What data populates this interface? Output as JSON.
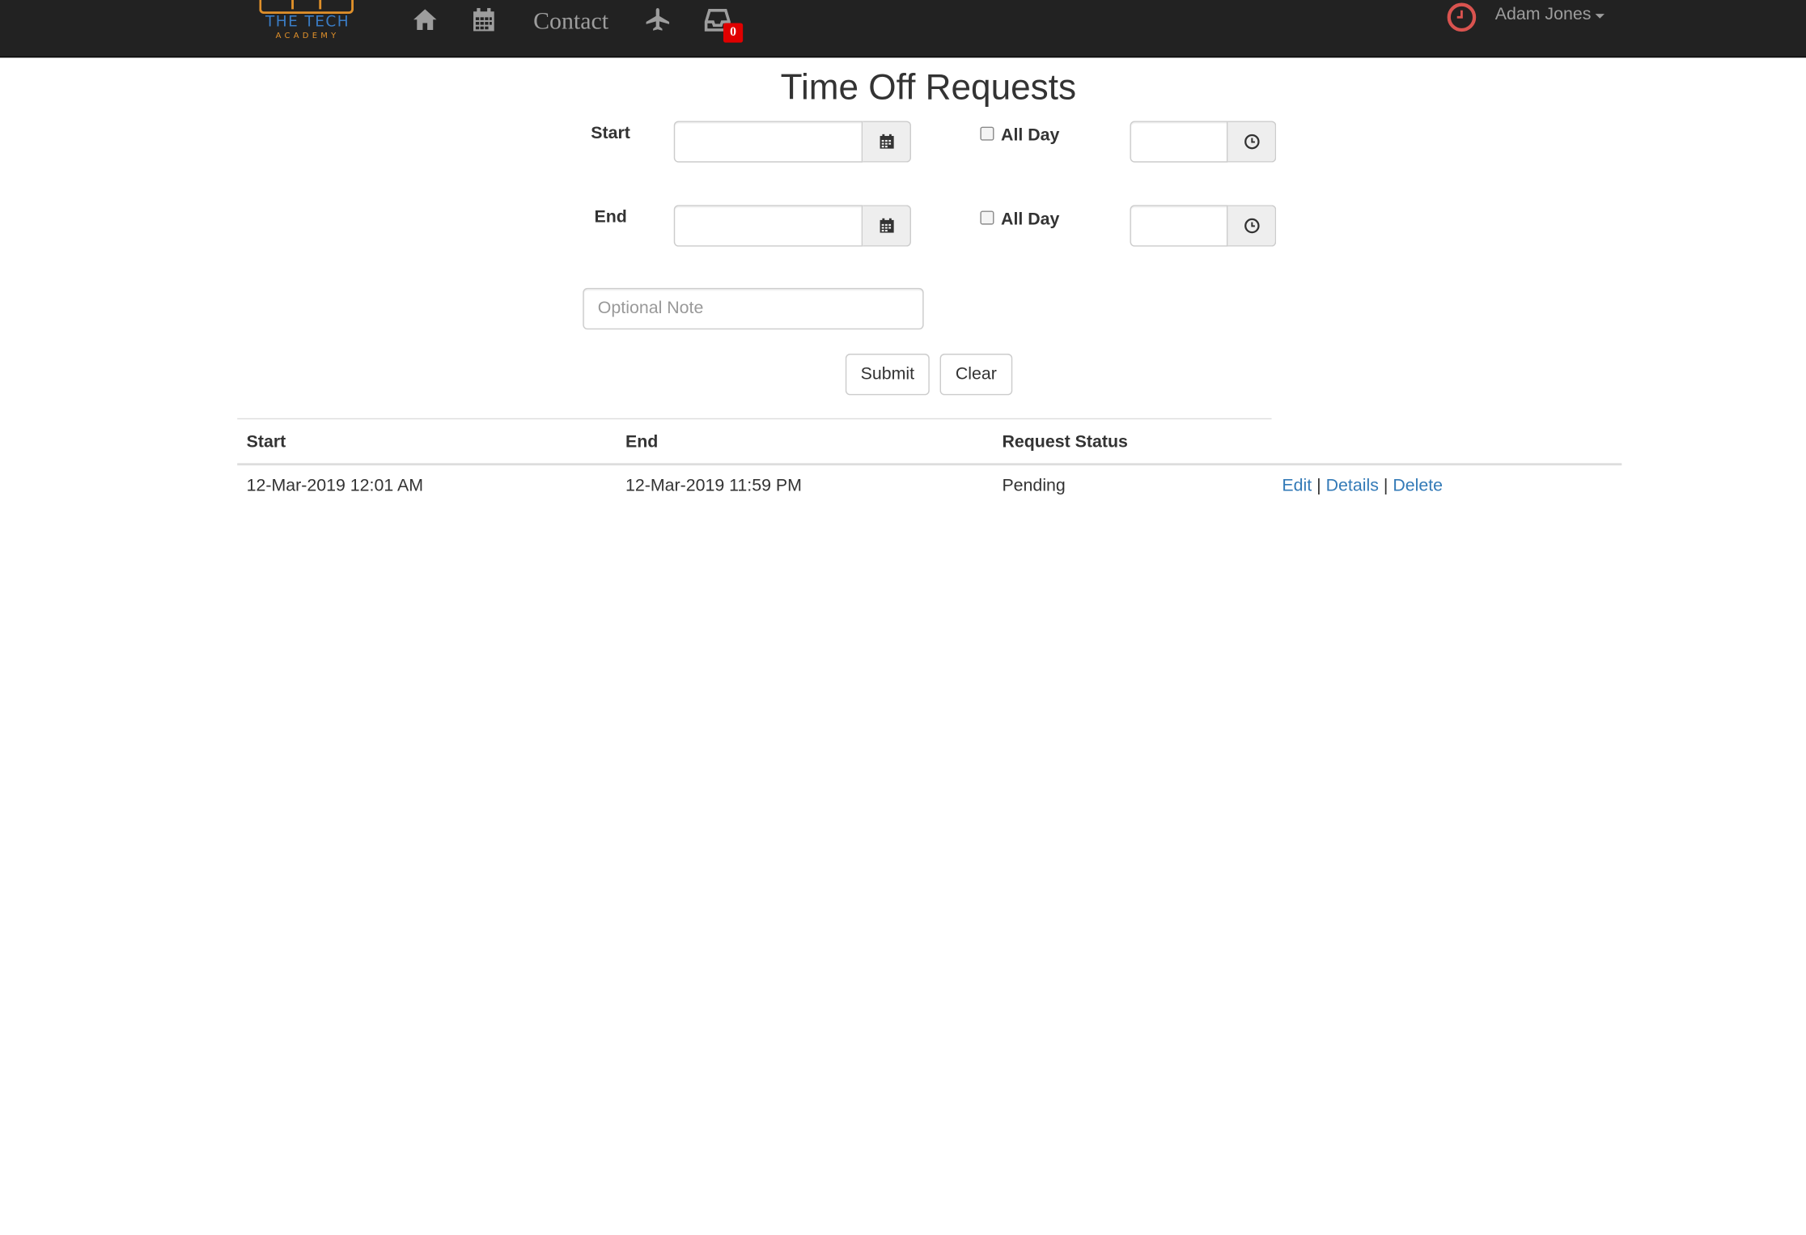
{
  "navbar": {
    "logo_title": "THE TECH",
    "logo_subtitle": "ACADEMY",
    "icons": [
      "home-icon",
      "calendar-icon",
      "plane-icon",
      "inbox-icon",
      "clock-icon"
    ],
    "contact_label": "Contact",
    "inbox_badge": "0",
    "user_name": "Adam Jones",
    "colors": {
      "background": "#222222",
      "link": "#9d9d9d",
      "badge": "#e00000",
      "clock": "#d9534f",
      "logo_blue": "#3a7cc4",
      "logo_orange": "#e0902a"
    }
  },
  "page": {
    "title": "Time Off Requests"
  },
  "form": {
    "start_label": "Start",
    "end_label": "End",
    "start_date_value": "",
    "end_date_value": "",
    "start_time_value": "",
    "end_time_value": "",
    "all_day_label": "All Day",
    "start_all_day_checked": false,
    "end_all_day_checked": false,
    "note_placeholder": "Optional Note",
    "submit_label": "Submit",
    "clear_label": "Clear"
  },
  "table": {
    "headers": [
      "Start",
      "End",
      "Request Status"
    ],
    "rows": [
      {
        "start": "12-Mar-2019 12:01 AM",
        "end": "12-Mar-2019 11:59 PM",
        "status": "Pending",
        "actions": {
          "edit": "Edit",
          "details": "Details",
          "delete": "Delete",
          "separator": "|"
        }
      }
    ],
    "link_color": "#337ab7"
  }
}
